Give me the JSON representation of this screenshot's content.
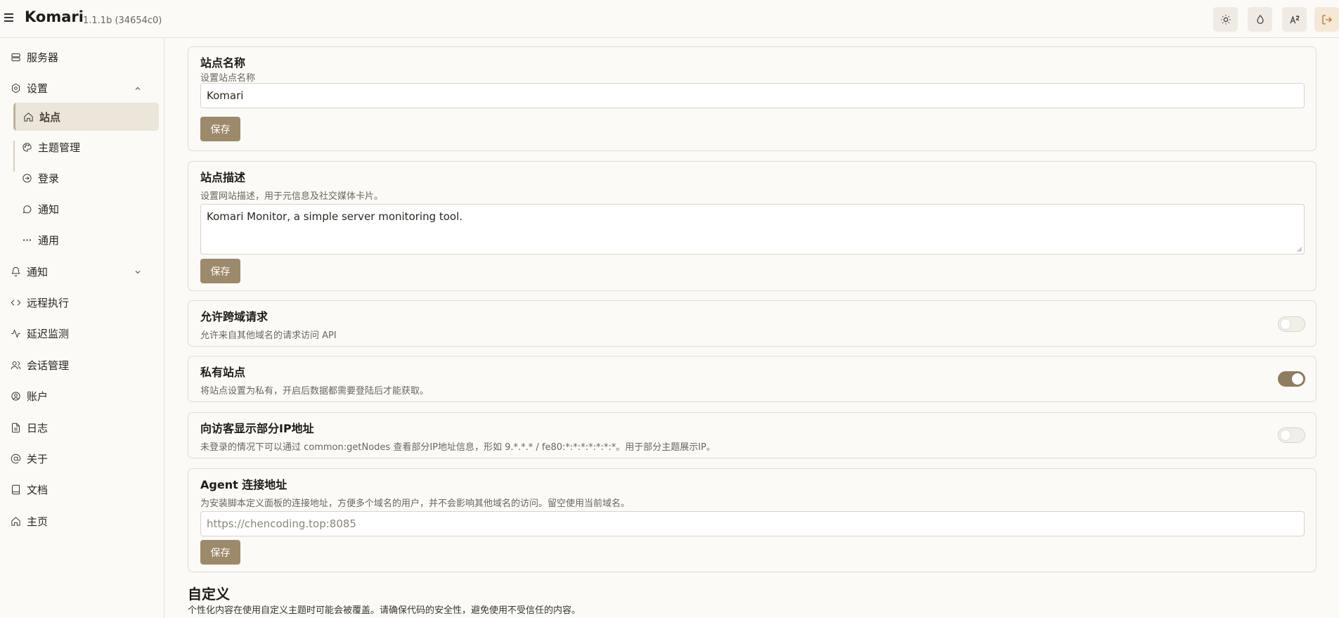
{
  "header": {
    "title": "Komari",
    "version": "1.1.1b (34654c0)",
    "buttons": [
      "sun-icon",
      "droplet-icon",
      "translate-icon",
      "logout-icon"
    ]
  },
  "sidebar": {
    "items": [
      {
        "label": "服务器",
        "icon": "server-icon"
      },
      {
        "label": "设置",
        "icon": "settings-icon"
      },
      {
        "label": "站点",
        "icon": "home-icon"
      },
      {
        "label": "主题管理",
        "icon": "palette-icon"
      },
      {
        "label": "登录",
        "icon": "login-icon"
      },
      {
        "label": "通知",
        "icon": "message-icon"
      },
      {
        "label": "通用",
        "icon": "more-icon"
      },
      {
        "label": "通知",
        "icon": "bell-icon"
      },
      {
        "label": "远程执行",
        "icon": "code-icon"
      },
      {
        "label": "延迟监测",
        "icon": "activity-icon"
      },
      {
        "label": "会话管理",
        "icon": "users-icon"
      },
      {
        "label": "账户",
        "icon": "user-circle-icon"
      },
      {
        "label": "日志",
        "icon": "file-icon"
      },
      {
        "label": "关于",
        "icon": "at-icon"
      },
      {
        "label": "文档",
        "icon": "book-icon"
      },
      {
        "label": "主页",
        "icon": "home-icon"
      }
    ]
  },
  "site_name": {
    "title": "站点名称",
    "desc": "设置站点名称",
    "value": "Komari",
    "save": "保存"
  },
  "site_desc": {
    "title": "站点描述",
    "desc": "设置网站描述，用于元信息及社交媒体卡片。",
    "value": "Komari Monitor, a simple server monitoring tool.",
    "save": "保存"
  },
  "cors": {
    "title": "允许跨域请求",
    "desc": "允许来自其他域名的请求访问 API",
    "enabled": false
  },
  "private_site": {
    "title": "私有站点",
    "desc": "将站点设置为私有，开启后数据都需要登陆后才能获取。",
    "enabled": true
  },
  "show_ip": {
    "title": "向访客显示部分IP地址",
    "desc": "未登录的情况下可以通过 common:getNodes 查看部分IP地址信息，形如 9.*.*.* / fe80:*:*:*:*:*:*:*。用于部分主题展示IP。",
    "enabled": false
  },
  "agent_url": {
    "title": "Agent 连接地址",
    "desc": "为安装脚本定义面板的连接地址，方便多个域名的用户，并不会影响其他域名的访问。留空使用当前域名。",
    "placeholder": "https://chencoding.top:8085",
    "save": "保存"
  },
  "custom": {
    "title": "自定义",
    "desc": "个性化内容在使用自定义主题时可能会被覆盖。请确保代码的安全性，避免使用不受信任的内容。"
  }
}
